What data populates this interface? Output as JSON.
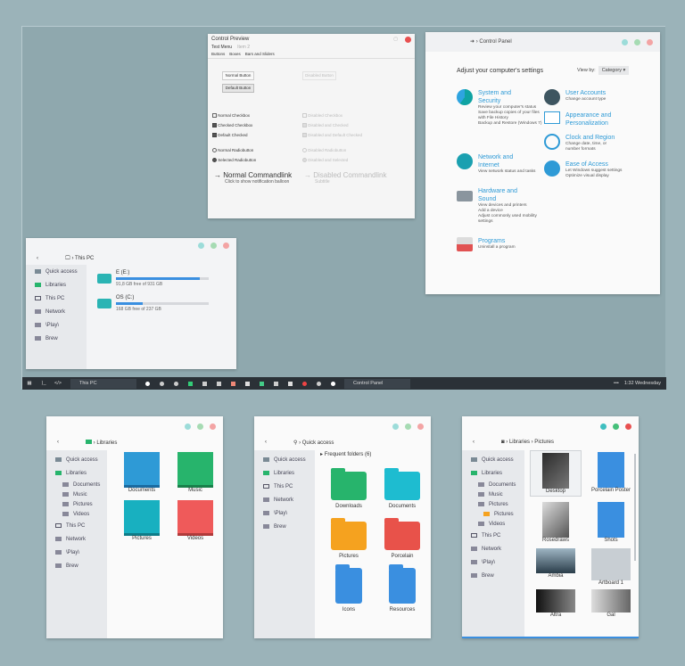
{
  "control_preview": {
    "title": "Control Preview",
    "menu": [
      "Test Menu",
      "Item 2"
    ],
    "tabs": [
      "Buttons",
      "Boxes",
      "Bars and Sliders"
    ],
    "buttons": {
      "normal": "Normal Button",
      "disabled": "Disabled Button",
      "default": "Default Button"
    },
    "checks": [
      {
        "label": "Normal Checkbox",
        "state": "none"
      },
      {
        "label": "Checked Checkbox",
        "state": "checked"
      },
      {
        "label": "Default Checked",
        "state": "checked"
      }
    ],
    "disabled_checks": [
      "Disabled Checkbox",
      "Disabled and Checked",
      "Disabled and Default Checked"
    ],
    "radios": [
      {
        "label": "Normal Radiobutton",
        "state": "none"
      },
      {
        "label": "Selected Radiobutton",
        "state": "selected"
      }
    ],
    "disabled_radios": [
      "Disabled Radiobutton",
      "Disabled and Selected"
    ],
    "commandlink": {
      "title": "Normal Commandlink",
      "note": "Click to show notification balloon"
    },
    "disabled_commandlink": {
      "title": "Disabled Commandlink",
      "note": "Subtitle"
    }
  },
  "control_panel": {
    "crumb": "Control Panel",
    "heading": "Adjust your computer's settings",
    "view_by_label": "View by:",
    "view_by_value": "Category",
    "left": [
      {
        "title": "System and Security",
        "links": [
          "Review your computer's status",
          "Save backup copies of your files with File History",
          "Backup and Restore (Windows 7)"
        ]
      },
      {
        "title": "Network and Internet",
        "links": [
          "View network status and tasks"
        ]
      },
      {
        "title": "Hardware and Sound",
        "links": [
          "View devices and printers",
          "Add a device",
          "Adjust commonly used mobility settings"
        ]
      },
      {
        "title": "Programs",
        "links": [
          "Uninstall a program"
        ]
      }
    ],
    "right": [
      {
        "title": "User Accounts",
        "links": [
          "Change account type"
        ]
      },
      {
        "title": "Appearance and Personalization",
        "links": []
      },
      {
        "title": "Clock and Region",
        "links": [
          "Change date, time, or number formats"
        ]
      },
      {
        "title": "Ease of Access",
        "links": [
          "Let Windows suggest settings",
          "Optimize visual display"
        ]
      }
    ]
  },
  "this_pc": {
    "crumb": "This PC",
    "sidebar": [
      "Quick access",
      "Libraries",
      "This PC",
      "Network",
      "\\Play\\",
      "Brew"
    ],
    "drives": [
      {
        "name": "E (E:)",
        "free": "91,8 GB free of 931 GB",
        "used_fraction": 0.9
      },
      {
        "name": "OS (C:)",
        "free": "168 GB free of 237 GB",
        "used_fraction": 0.29
      }
    ]
  },
  "taskbar": {
    "task1": "This PC",
    "task2": "Control Panel",
    "clock": "1:32 Wednesday"
  },
  "libraries": {
    "crumb": "Libraries",
    "sidebar": [
      "Quick access",
      "Libraries",
      "Documents",
      "Music",
      "Pictures",
      "Videos",
      "This PC",
      "Network",
      "\\Play\\",
      "Brew"
    ],
    "items": [
      "Documents",
      "Music",
      "Pictures",
      "Videos"
    ]
  },
  "quick_access": {
    "crumb": "Quick access",
    "sidebar": [
      "Quick access",
      "Libraries",
      "This PC",
      "Network",
      "\\Play\\",
      "Brew"
    ],
    "section": "Frequent folders (6)",
    "folders": [
      "Downloads",
      "Documents",
      "Pictures",
      "Porcelain",
      "Icons",
      "Resources"
    ]
  },
  "pictures": {
    "crumb": "Libraries  ›  Pictures",
    "sidebar": [
      "Quick access",
      "Libraries",
      "Documents",
      "Music",
      "Pictures",
      "Pictures",
      "Videos",
      "This PC",
      "Network",
      "\\Play\\",
      "Brew"
    ],
    "items": [
      "Desktop",
      "Porcelain Poster",
      "Rosedraws",
      "Shots",
      "Ambia",
      "Artboard 1",
      "Altra",
      "Gal"
    ]
  },
  "colors": {
    "accent": "#2e9ad6",
    "drive_bar": "#3a8fe0",
    "taskbar": "#2b3137"
  }
}
